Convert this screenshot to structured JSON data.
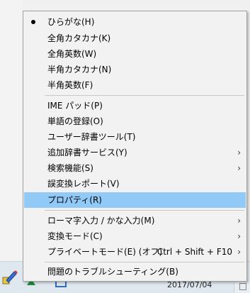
{
  "menu": {
    "items": [
      {
        "label": "ひらがな(H)",
        "checked": true
      },
      {
        "label": "全角カタカナ(K)"
      },
      {
        "label": "全角英数(W)"
      },
      {
        "label": "半角カタカナ(N)"
      },
      {
        "label": "半角英数(F)"
      },
      {
        "label": "IME パッド(P)"
      },
      {
        "label": "単語の登録(O)"
      },
      {
        "label": "ユーザー辞書ツール(T)"
      },
      {
        "label": "追加辞書サービス(Y)",
        "submenu": true
      },
      {
        "label": "検索機能(S)",
        "submenu": true
      },
      {
        "label": "誤変換レポート(V)"
      },
      {
        "label": "プロパティ(R)",
        "highlighted": true
      },
      {
        "label": "ローマ字入力 / かな入力(M)",
        "submenu": true
      },
      {
        "label": "変換モード(C)",
        "submenu": true
      },
      {
        "label": "プライベートモード(E) (オフ)",
        "shortcut": "Ctrl + Shift + F10",
        "submenu": true
      },
      {
        "label": "問題のトラブルシューティング(B)"
      }
    ],
    "submenu_arrow": "›",
    "highlight_color": "#91c9f7"
  },
  "taskbar": {
    "date": "2017/07/04",
    "ime_icon": "ime-pen-icon"
  }
}
